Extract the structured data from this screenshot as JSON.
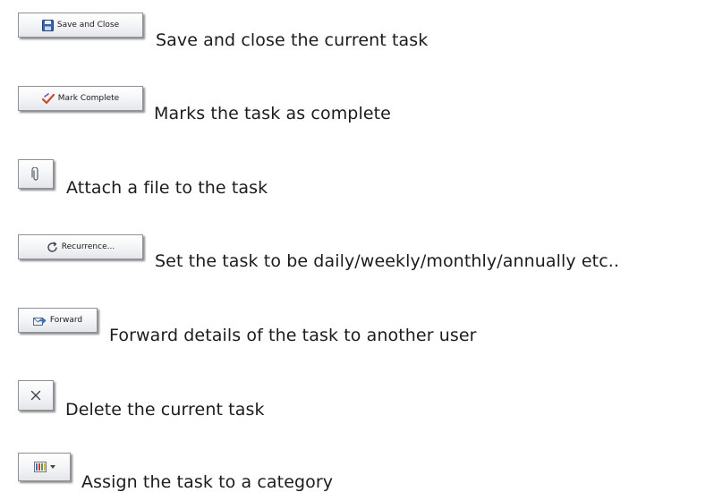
{
  "items": [
    {
      "button_label": "Save and Close",
      "icon": "save-icon",
      "description": "Save and close the current task"
    },
    {
      "button_label": "Mark Complete",
      "icon": "mark-complete-icon",
      "description": "Marks the task as complete"
    },
    {
      "button_label": "",
      "icon": "paperclip-icon",
      "description": "Attach a file to the task"
    },
    {
      "button_label": "Recurrence...",
      "icon": "recurrence-icon",
      "description": "Set the task to be daily/weekly/monthly/annually etc.."
    },
    {
      "button_label": "Forward",
      "icon": "forward-icon",
      "description": "Forward details of the task to another user"
    },
    {
      "button_label": "",
      "icon": "close-icon",
      "description": "Delete the current task"
    },
    {
      "button_label": "",
      "icon": "categorize-icon",
      "description": "Assign the task to a category"
    }
  ],
  "colors": {
    "save": "#2f5fa8",
    "complete": "#d04a2a",
    "forward": "#2f6fc0",
    "category_bars": [
      "#3d6cc6",
      "#d4392b",
      "#4aa043",
      "#e2a21f"
    ]
  }
}
